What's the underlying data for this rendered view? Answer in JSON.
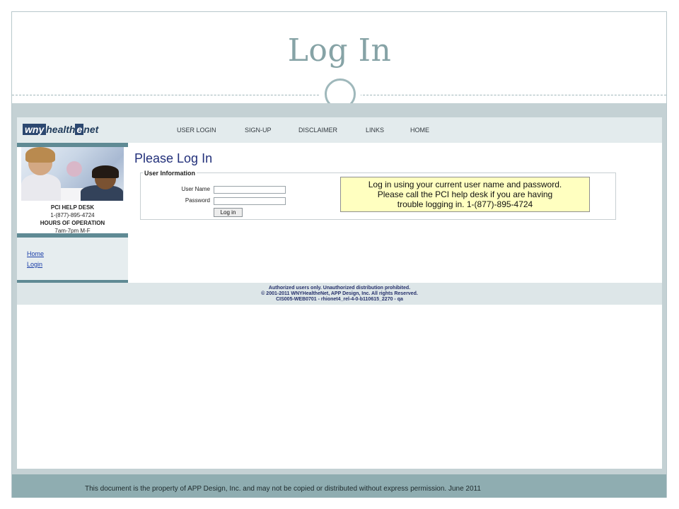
{
  "slide": {
    "title": "Log In",
    "footer": "This document is the property of APP Design, Inc. and may not be copied or distributed without express permission.  June 2011"
  },
  "colors": {
    "title": "#86a3a6",
    "band": "#c4d1d4",
    "footer_band": "#8fadb1",
    "accent_bar": "#5f8a94",
    "heading": "#22307a",
    "notice_bg": "#ffffc0"
  },
  "app": {
    "logo": {
      "part1": "wny",
      "part2": "health",
      "part3": "e",
      "part4": "net"
    },
    "nav": [
      {
        "label": "USER LOGIN"
      },
      {
        "label": "SIGN-UP"
      },
      {
        "label": "DISCLAIMER"
      },
      {
        "label": "LINKS"
      },
      {
        "label": "HOME"
      }
    ],
    "sidebar": {
      "helpdesk_title": "PCI HELP DESK",
      "helpdesk_phone": "1-(877)-895-4724",
      "hours_title": "HOURS OF OPERATION",
      "hours": "7am-7pm M-F",
      "links": [
        {
          "label": "Home"
        },
        {
          "label": "Login"
        }
      ]
    },
    "main": {
      "heading": "Please Log In",
      "section_legend": "User Information",
      "username_label": "User Name",
      "username_value": "",
      "password_label": "Password",
      "password_value": "",
      "login_button": "Log in",
      "notice_lines": [
        "Log in using your current user name and password.",
        "Please call the PCI help desk if you are having",
        "trouble logging in.   1-(877)-895-4724"
      ]
    },
    "footer_lines": [
      "Authorized users only. Unauthorized distribution prohibited.",
      "© 2001-2011 WNYHealtheNet, APP Design, Inc. All rights Reserved.",
      "CIS005-WEB0701 - rhionet4_rel-4-0-b110615_2270 - qa"
    ]
  }
}
